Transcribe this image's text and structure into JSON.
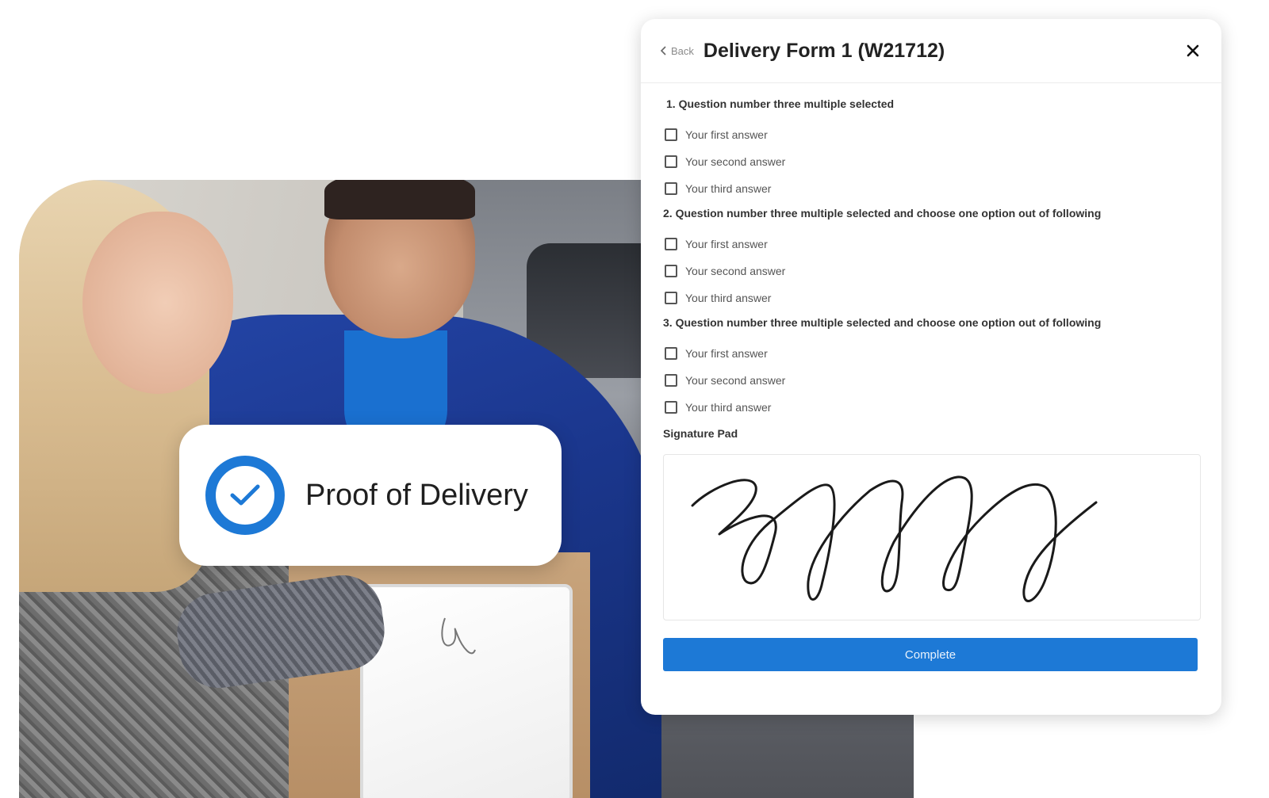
{
  "pod_card": {
    "title": "Proof of Delivery",
    "icon": "check-circle-icon",
    "accent": "#1d79d6"
  },
  "form": {
    "back_label": "Back",
    "title": "Delivery Form 1 (W21712)",
    "close_icon": "close-icon",
    "questions": [
      {
        "label": "1. Question number three multiple selected",
        "answers": [
          "Your first answer",
          "Your second answer",
          "Your third answer"
        ]
      },
      {
        "label": "2. Question number three multiple selected and choose one option out of following",
        "answers": [
          "Your first answer",
          "Your second answer",
          "Your third answer"
        ]
      },
      {
        "label": "3. Question number three multiple selected and choose one option out of following",
        "answers": [
          "Your first answer",
          "Your second answer",
          "Your third answer"
        ]
      }
    ],
    "signature_label": "Signature Pad",
    "complete_label": "Complete",
    "button_color": "#1d79d6"
  }
}
